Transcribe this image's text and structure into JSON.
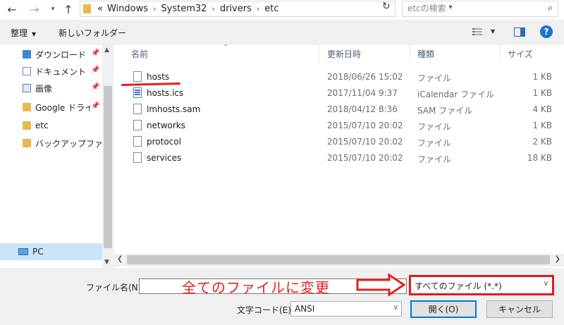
{
  "address_bar": {
    "crumbs": [
      "«",
      "Windows",
      "System32",
      "drivers",
      "etc"
    ],
    "search_placeholder": "etcの検索"
  },
  "toolbar": {
    "organize_label": "整理",
    "new_folder_label": "新しいフォルダー"
  },
  "nav_pane": {
    "items": [
      {
        "label": "ダウンロード",
        "icon": "download-folder-icon",
        "pinned": true
      },
      {
        "label": "ドキュメント",
        "icon": "documents-icon",
        "pinned": true
      },
      {
        "label": "画像",
        "icon": "pictures-icon",
        "pinned": true
      },
      {
        "label": "Google ドライブ",
        "icon": "folder-icon",
        "pinned": true
      },
      {
        "label": "etc",
        "icon": "folder-icon",
        "pinned": false
      },
      {
        "label": "バックアップファイル",
        "icon": "folder-icon",
        "pinned": false
      }
    ],
    "pc_label": "PC"
  },
  "file_list": {
    "columns": [
      "名前",
      "更新日時",
      "種類",
      "サイズ"
    ],
    "rows": [
      {
        "name": "hosts",
        "date": "2018/06/26 15:02",
        "type": "ファイル",
        "size": "1 KB",
        "icon": "file-icon"
      },
      {
        "name": "hosts.ics",
        "date": "2017/11/04 9:37",
        "type": "iCalendar ファイル",
        "size": "1 KB",
        "icon": "calendar-file-icon"
      },
      {
        "name": "lmhosts.sam",
        "date": "2018/04/12 8:36",
        "type": "SAM ファイル",
        "size": "4 KB",
        "icon": "file-icon"
      },
      {
        "name": "networks",
        "date": "2015/07/10 20:02",
        "type": "ファイル",
        "size": "1 KB",
        "icon": "file-icon"
      },
      {
        "name": "protocol",
        "date": "2015/07/10 20:02",
        "type": "ファイル",
        "size": "2 KB",
        "icon": "file-icon"
      },
      {
        "name": "services",
        "date": "2015/07/10 20:02",
        "type": "ファイル",
        "size": "18 KB",
        "icon": "file-icon"
      }
    ]
  },
  "bottom": {
    "filename_label": "ファイル名(N):",
    "filename_value": "",
    "annotation": "全てのファイルに変更",
    "filter_value": "すべてのファイル  (*.*)",
    "encoding_label": "文字コード(E):",
    "encoding_value": "ANSI",
    "open_label": "開く(O)",
    "cancel_label": "キャンセル"
  },
  "colors": {
    "annotation_red": "#e42020",
    "accent_blue": "#0078d7",
    "selection_bg": "#cce4f7"
  }
}
